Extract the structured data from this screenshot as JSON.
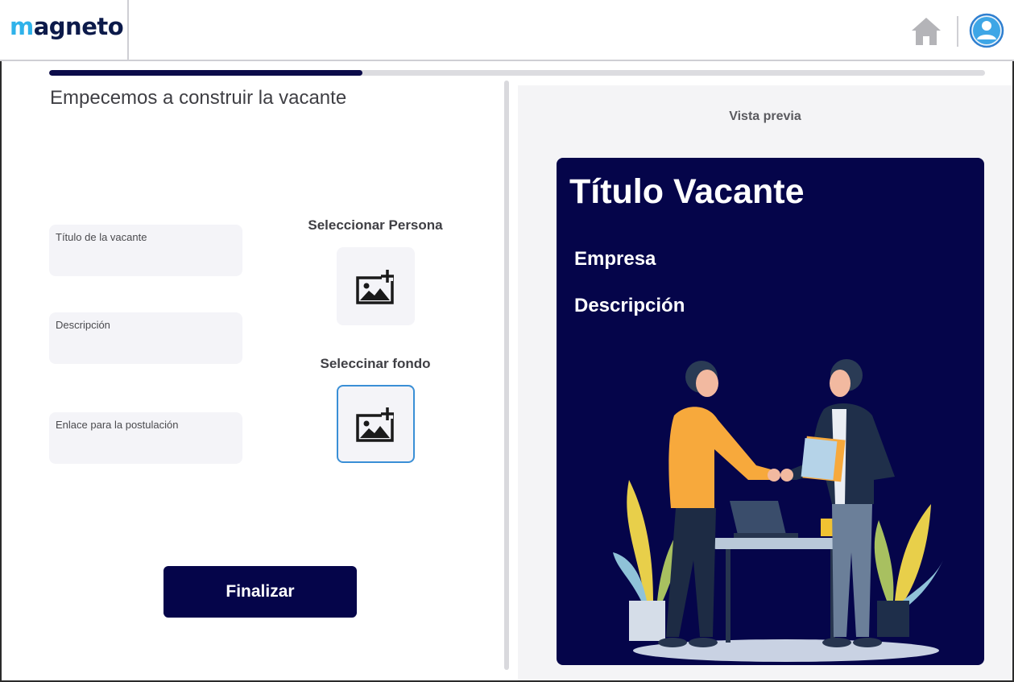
{
  "header": {
    "logo_text_m": "m",
    "logo_text_rest": "agneto"
  },
  "progress": {
    "value_fraction": 0.335
  },
  "form": {
    "title": "Empecemos a construir la vacante",
    "fields": {
      "title_label": "Título de la vacante",
      "description_label": "Descripción",
      "link_label": "Enlace para la postulación"
    },
    "select_person_label": "Seleccionar Persona",
    "select_background_label": "Seleccinar fondo",
    "finish_label": "Finalizar"
  },
  "preview": {
    "label": "Vista previa",
    "card_title": "Título Vacante",
    "card_company": "Empresa",
    "card_description": "Descripción"
  },
  "icons": {
    "home": "home-icon",
    "user": "user-avatar-icon",
    "add_image": "add-image-icon"
  },
  "colors": {
    "brand_navy": "#05054a",
    "logo_blue": "#2fb2ea",
    "active_border": "#3a8fd6",
    "field_bg": "#f4f4f8"
  }
}
